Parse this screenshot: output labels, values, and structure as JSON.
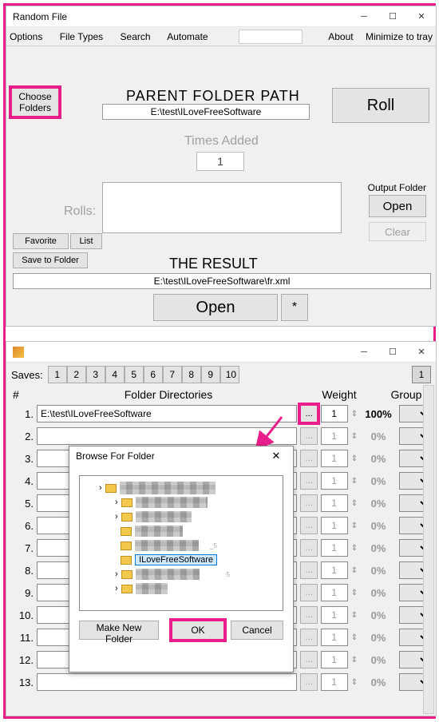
{
  "win1": {
    "title": "Random File",
    "menu": {
      "options": "Options",
      "fileTypes": "File Types",
      "search": "Search",
      "automate": "Automate",
      "about": "About",
      "minimize": "Minimize to tray"
    },
    "chooseFolders": "Choose\nFolders",
    "parentFolderPathLabel": "PARENT FOLDER PATH",
    "parentFolderPath": "E:\\test\\ILoveFreeSoftware",
    "rollLabel": "Roll",
    "timesAddedLabel": "Times Added",
    "timesAdded": "1",
    "rollsLabel": "Rolls:",
    "outputFolderLabel": "Output Folder",
    "openLabel": "Open",
    "clearLabel": "Clear",
    "favorite": "Favorite",
    "list": "List",
    "saveToFolder": "Save to Folder",
    "theResultLabel": "THE RESULT",
    "resultPath": "E:\\test\\ILoveFreeSoftware\\fr.xml",
    "open2": "Open",
    "star": "*"
  },
  "win2": {
    "savesLabel": "Saves:",
    "saves": [
      "1",
      "2",
      "3",
      "4",
      "5",
      "6",
      "7",
      "8",
      "9",
      "10"
    ],
    "savesExtra": "1",
    "headers": {
      "num": "#",
      "dir": "Folder Directories",
      "weight": "Weight",
      "group": "Group"
    },
    "rows": [
      {
        "idx": "1.",
        "path": "E:\\test\\ILoveFreeSoftware",
        "weight": "1",
        "pct": "100%",
        "hl": true,
        "dim": false
      },
      {
        "idx": "2.",
        "path": "",
        "weight": "1",
        "pct": "0%",
        "dim": true
      },
      {
        "idx": "3.",
        "path": "",
        "weight": "1",
        "pct": "0%",
        "dim": true
      },
      {
        "idx": "4.",
        "path": "",
        "weight": "1",
        "pct": "0%",
        "dim": true
      },
      {
        "idx": "5.",
        "path": "",
        "weight": "1",
        "pct": "0%",
        "dim": true
      },
      {
        "idx": "6.",
        "path": "",
        "weight": "1",
        "pct": "0%",
        "dim": true
      },
      {
        "idx": "7.",
        "path": "",
        "weight": "1",
        "pct": "0%",
        "dim": true
      },
      {
        "idx": "8.",
        "path": "",
        "weight": "1",
        "pct": "0%",
        "dim": true
      },
      {
        "idx": "9.",
        "path": "",
        "weight": "1",
        "pct": "0%",
        "dim": true
      },
      {
        "idx": "10.",
        "path": "",
        "weight": "1",
        "pct": "0%",
        "dim": true
      },
      {
        "idx": "11.",
        "path": "",
        "weight": "1",
        "pct": "0%",
        "dim": true
      },
      {
        "idx": "12.",
        "path": "",
        "weight": "1",
        "pct": "0%",
        "dim": true
      },
      {
        "idx": "13.",
        "path": "",
        "weight": "1",
        "pct": "0%",
        "dim": true
      }
    ],
    "browse": "..."
  },
  "bff": {
    "title": "Browse For Folder",
    "selected": "ILoveFreeSoftware",
    "makeNew": "Make New Folder",
    "ok": "OK",
    "cancel": "Cancel"
  }
}
